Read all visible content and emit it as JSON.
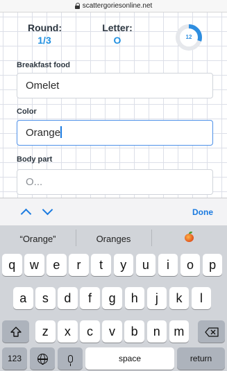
{
  "browser": {
    "url": "scattergoriesonline.net"
  },
  "game": {
    "round_label": "Round:",
    "round_value": "1/3",
    "letter_label": "Letter:",
    "letter_value": "O",
    "timer": {
      "value": "12",
      "progress": 0.3,
      "color": "#2e8ee0"
    },
    "categories": [
      {
        "label": "Breakfast food",
        "value": "Omelet",
        "placeholder": "",
        "focused": false
      },
      {
        "label": "Color",
        "value": "Orange",
        "placeholder": "",
        "focused": true
      },
      {
        "label": "Body part",
        "value": "",
        "placeholder": "O...",
        "focused": false
      }
    ]
  },
  "accessory": {
    "prev_icon": "chevron-up-icon",
    "next_icon": "chevron-down-icon",
    "done_label": "Done"
  },
  "keyboard": {
    "suggestions": [
      "“Orange”",
      "Oranges",
      "peach-emoji"
    ],
    "row1": [
      "q",
      "w",
      "e",
      "r",
      "t",
      "y",
      "u",
      "i",
      "o",
      "p"
    ],
    "row2": [
      "a",
      "s",
      "d",
      "f",
      "g",
      "h",
      "j",
      "k",
      "l"
    ],
    "row3": [
      "z",
      "x",
      "c",
      "v",
      "b",
      "n",
      "m"
    ],
    "numbers_label": "123",
    "space_label": "space",
    "return_label": "return"
  }
}
